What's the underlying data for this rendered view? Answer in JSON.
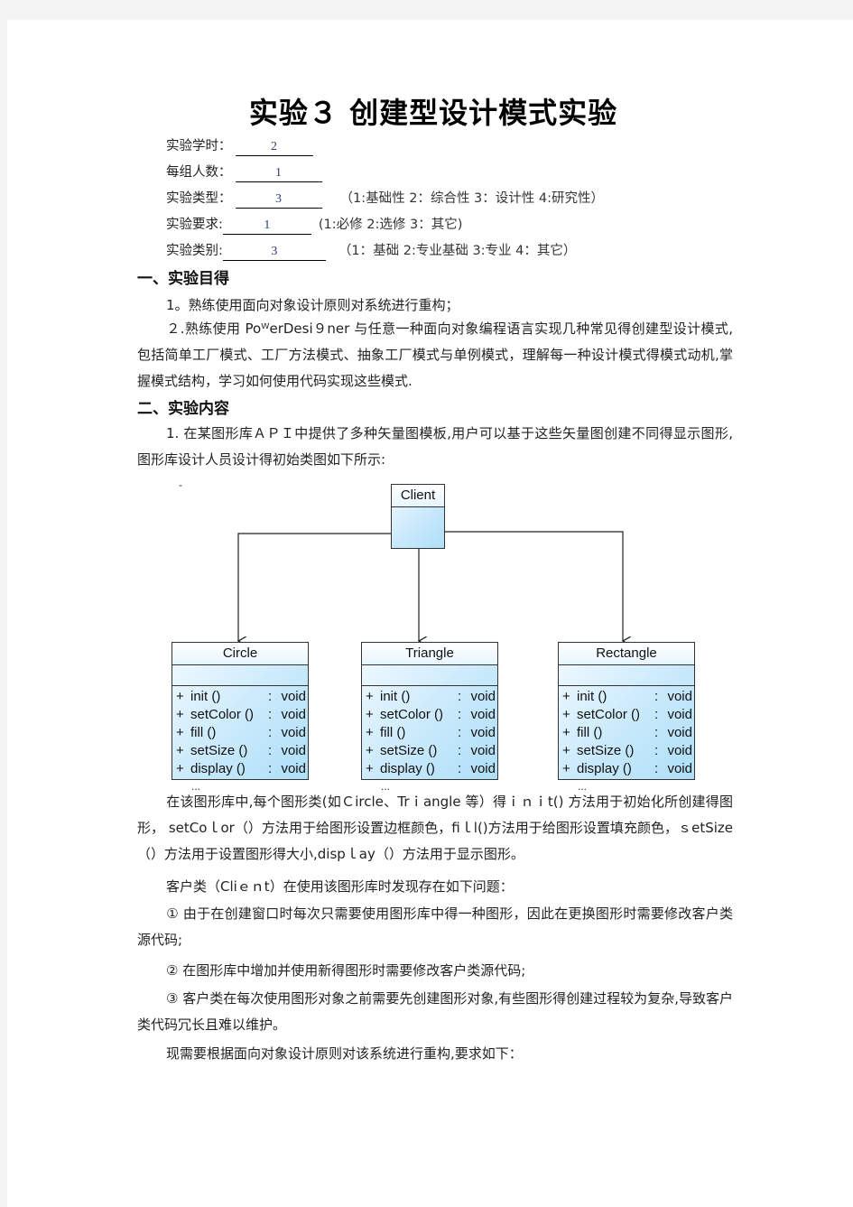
{
  "title": "实验３  创建型设计模式实验",
  "meta": [
    {
      "label": "实验学时：",
      "value": "2",
      "options": ""
    },
    {
      "label": "每组人数：",
      "value": "1",
      "options": ""
    },
    {
      "label": "实验类型：",
      "value": "3",
      "options": "（1:基础性     2：综合性        3：设计性   4:研究性）"
    },
    {
      "label": "实验要求:",
      "value": "1",
      "options": "(1:必修      2:选修       3：其它)"
    },
    {
      "label": "实验类别:",
      "value": "3",
      "options": "（1：基础        2:专业基础     3:专业       4：其它）"
    }
  ],
  "section1": {
    "heading": "一、实验目得",
    "items": [
      "1。熟练使用面向对象设计原则对系统进行重构；",
      "２.熟练使用 PoᵂerDesi９ner 与任意一种面向对象编程语言实现几种常见得创建型设计模式,包括简单工厂模式、工厂方法模式、抽象工厂模式与单例模式，理解每一种设计模式得模式动机,掌握模式结构，学习如何使用代码实现这些模式."
    ]
  },
  "section2": {
    "heading": "二、实验内容",
    "intro": "1. 在某图形库ＡＰＩ中提供了多种矢量图模板,用户可以基于这些矢量图创建不同得显示图形,图形库设计人员设计得初始类图如下所示:",
    "stray_mark": "-",
    "diagram": {
      "client": {
        "name": "Client"
      },
      "classes": [
        {
          "name": "Circle",
          "methods": [
            {
              "vis": "+",
              "name": "init  ()",
              "ret": "void"
            },
            {
              "vis": "+",
              "name": "setColor  ()",
              "ret": "void"
            },
            {
              "vis": "+",
              "name": "fill  ()",
              "ret": "void"
            },
            {
              "vis": "+",
              "name": "setSize  ()",
              "ret": "void"
            },
            {
              "vis": "+",
              "name": "display  ()",
              "ret": "void"
            }
          ],
          "more": "..."
        },
        {
          "name": "Triangle",
          "methods": [
            {
              "vis": "+",
              "name": "init  ()",
              "ret": "void"
            },
            {
              "vis": "+",
              "name": "setColor  ()",
              "ret": "void"
            },
            {
              "vis": "+",
              "name": "fill  ()",
              "ret": "void"
            },
            {
              "vis": "+",
              "name": "setSize  ()",
              "ret": "void"
            },
            {
              "vis": "+",
              "name": "display  ()",
              "ret": "void"
            }
          ],
          "more": "..."
        },
        {
          "name": "Rectangle",
          "methods": [
            {
              "vis": "+",
              "name": "init  ()",
              "ret": "void"
            },
            {
              "vis": "+",
              "name": "setColor  ()",
              "ret": "void"
            },
            {
              "vis": "+",
              "name": "fill  ()",
              "ret": "void"
            },
            {
              "vis": "+",
              "name": "setSize  ()",
              "ret": "void"
            },
            {
              "vis": "+",
              "name": "display  ()",
              "ret": "void"
            }
          ],
          "more": "..."
        }
      ]
    },
    "description": "在该图形库中,每个图形类(如Ｃircle、Trｉangle 等）得ｉｎｉt() 方法用于初始化所创建得图形， setCoｌor（）方法用于给图形设置边框颜色，fiｌl()方法用于给图形设置填充颜色，ｓetSize（）方法用于设置图形得大小,dispｌay（）方法用于显示图形。",
    "problem_intro": "客户类（Cliｅｎt）在使用该图形库时发现存在如下问题：",
    "problems": [
      "①  由于在创建窗口时每次只需要使用图形库中得一种图形，因此在更换图形时需要修改客户类源代码;",
      "② 在图形库中增加并使用新得图形时需要修改客户类源代码;",
      "③ 客户类在每次使用图形对象之前需要先创建图形对象,有些图形得创建过程较为复杂,导致客户类代码冗长且难以维护。"
    ],
    "requirement": "现需要根据面向对象设计原则对该系统进行重构,要求如下："
  }
}
